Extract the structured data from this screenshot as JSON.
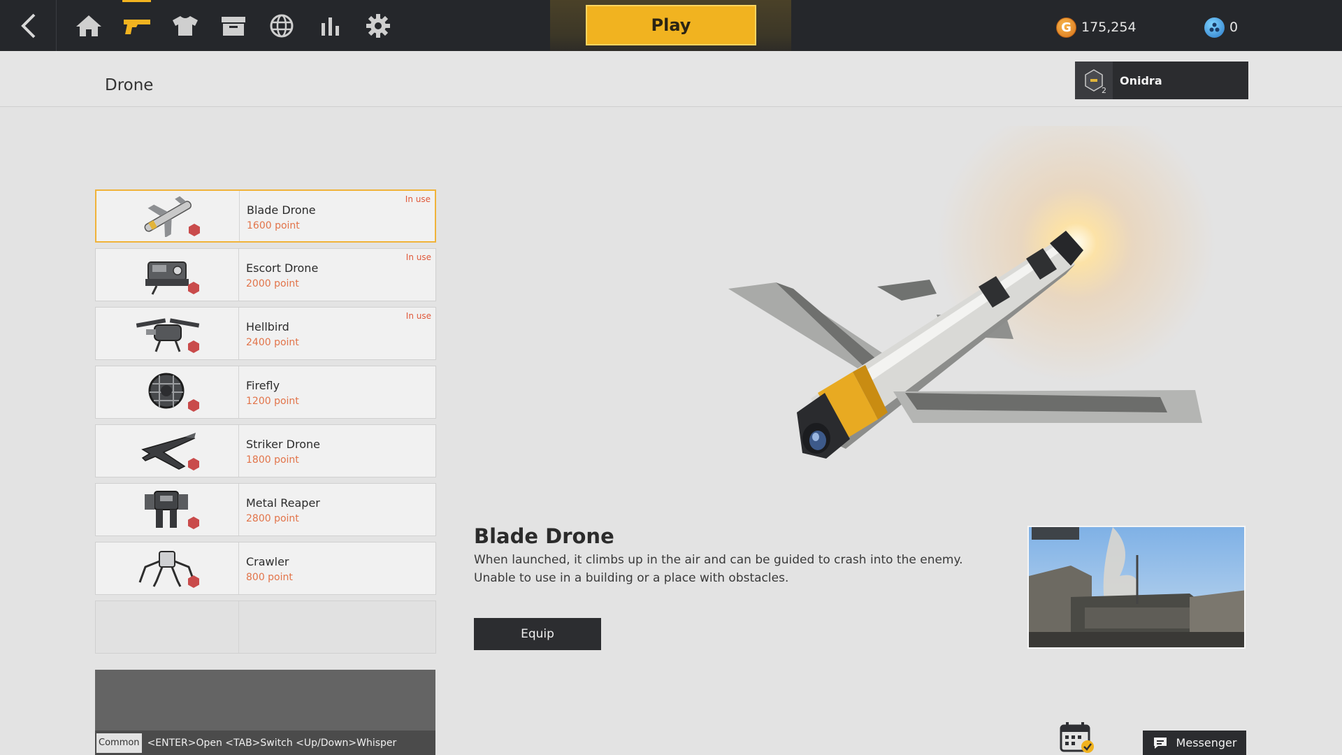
{
  "header": {
    "play_label": "Play",
    "gold_symbol": "G",
    "gold_amount": "175,254",
    "token_amount": "0",
    "nav_icons": [
      "home-icon",
      "weapon-icon",
      "outfit-icon",
      "storage-icon",
      "globe-icon",
      "stats-icon",
      "gear-icon"
    ],
    "active_nav": "weapon-icon",
    "accent_color": "#f1b320"
  },
  "page": {
    "title": "Drone"
  },
  "user": {
    "name": "Onidra",
    "rank": "2"
  },
  "drones": [
    {
      "name": "Blade Drone",
      "points": "1600 point",
      "status": "In use",
      "selected": true
    },
    {
      "name": "Escort Drone",
      "points": "2000 point",
      "status": "In use",
      "selected": false
    },
    {
      "name": "Hellbird",
      "points": "2400 point",
      "status": "In use",
      "selected": false
    },
    {
      "name": "Firefly",
      "points": "1200 point",
      "status": "",
      "selected": false
    },
    {
      "name": "Striker Drone",
      "points": "1800 point",
      "status": "",
      "selected": false
    },
    {
      "name": "Metal Reaper",
      "points": "2800 point",
      "status": "",
      "selected": false
    },
    {
      "name": "Crawler",
      "points": "800 point",
      "status": "",
      "selected": false
    }
  ],
  "detail": {
    "title": "Blade Drone",
    "description_line1": "When launched, it climbs up in the air and can be guided to crash into the enemy.",
    "description_line2": "Unable to use in a building or a place with obstacles.",
    "equip_label": "Equip"
  },
  "chat": {
    "channel": "Common",
    "hint": "<ENTER>Open <TAB>Switch <Up/Down>Whisper"
  },
  "footer": {
    "messenger_label": "Messenger"
  }
}
